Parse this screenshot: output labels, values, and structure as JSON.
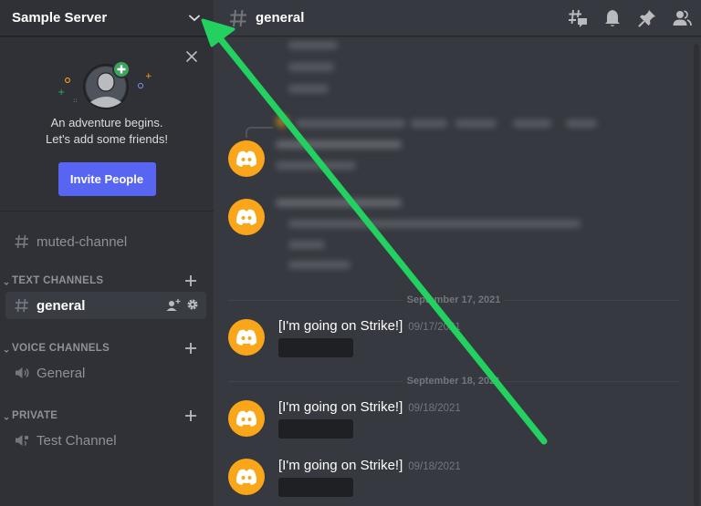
{
  "server": {
    "name": "Sample Server"
  },
  "invite_card": {
    "line1": "An adventure begins.",
    "line2": "Let's add some friends!",
    "button_label": "Invite People"
  },
  "sidebar": {
    "standalone_channels": [
      {
        "name": "muted-channel",
        "type": "text"
      }
    ],
    "categories": [
      {
        "label": "TEXT CHANNELS",
        "channels": [
          {
            "name": "general",
            "type": "text",
            "active": true
          }
        ]
      },
      {
        "label": "VOICE CHANNELS",
        "channels": [
          {
            "name": "General",
            "type": "voice"
          }
        ]
      },
      {
        "label": "PRIVATE",
        "channels": [
          {
            "name": "Test Channel",
            "type": "voice-locked"
          }
        ]
      }
    ]
  },
  "channel_header": {
    "title": "general",
    "icons": [
      "threads-icon",
      "bell-icon",
      "pin-icon",
      "members-icon"
    ]
  },
  "messages": {
    "dividers": [
      "September 17, 2021",
      "September 18, 2021"
    ],
    "items": [
      {
        "author": "[I'm going on Strike!]",
        "timestamp": "09/17/2021",
        "content": "[redacted]"
      },
      {
        "author": "[I'm going on Strike!]",
        "timestamp": "09/18/2021",
        "content": "[redacted]"
      },
      {
        "author": "[I'm going on Strike!]",
        "timestamp": "09/18/2021",
        "content": "[redacted]"
      }
    ]
  },
  "annotation": {
    "type": "arrow",
    "color": "#23d160",
    "points_to": "server-menu-chevron"
  },
  "colors": {
    "sidebar_bg": "#2f3136",
    "main_bg": "#36393f",
    "accent": "#5865f2",
    "avatar": "#faa61a",
    "arrow": "#23d160"
  }
}
